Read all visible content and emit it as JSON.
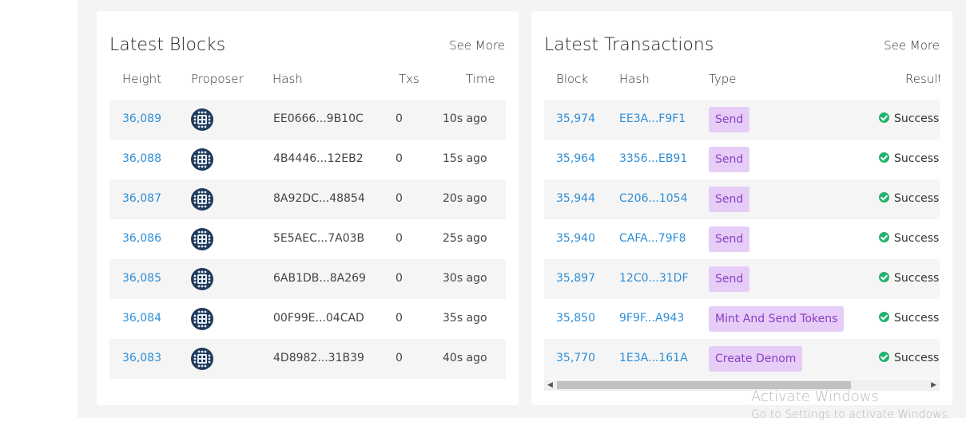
{
  "latest_blocks": {
    "title": "Latest Blocks",
    "see_more": "See More",
    "columns": [
      "Height",
      "Proposer",
      "Hash",
      "Txs",
      "Time"
    ],
    "rows": [
      {
        "height": "36,089",
        "hash": "EE0666...9B10C",
        "txs": "0",
        "time": "10s ago"
      },
      {
        "height": "36,088",
        "hash": "4B4446...12EB2",
        "txs": "0",
        "time": "15s ago"
      },
      {
        "height": "36,087",
        "hash": "8A92DC...48854",
        "txs": "0",
        "time": "20s ago"
      },
      {
        "height": "36,086",
        "hash": "5E5AEC...7A03B",
        "txs": "0",
        "time": "25s ago"
      },
      {
        "height": "36,085",
        "hash": "6AB1DB...8A269",
        "txs": "0",
        "time": "30s ago"
      },
      {
        "height": "36,084",
        "hash": "00F99E...04CAD",
        "txs": "0",
        "time": "35s ago"
      },
      {
        "height": "36,083",
        "hash": "4D8982...31B39",
        "txs": "0",
        "time": "40s ago"
      }
    ]
  },
  "latest_transactions": {
    "title": "Latest Transactions",
    "see_more": "See More",
    "columns": [
      "Block",
      "Hash",
      "Type",
      "Result"
    ],
    "rows": [
      {
        "block": "35,974",
        "hash": "EE3A...F9F1",
        "type": "Send",
        "result": "Success"
      },
      {
        "block": "35,964",
        "hash": "3356...EB91",
        "type": "Send",
        "result": "Success"
      },
      {
        "block": "35,944",
        "hash": "C206...1054",
        "type": "Send",
        "result": "Success"
      },
      {
        "block": "35,940",
        "hash": "CAFA...79F8",
        "type": "Send",
        "result": "Success"
      },
      {
        "block": "35,897",
        "hash": "12C0...31DF",
        "type": "Send",
        "result": "Success"
      },
      {
        "block": "35,850",
        "hash": "9F9F...A943",
        "type": "Mint And Send Tokens",
        "result": "Success"
      },
      {
        "block": "35,770",
        "hash": "1E3A...161A",
        "type": "Create Denom",
        "result": "Success"
      }
    ]
  },
  "watermark": {
    "line1": "Activate Windows",
    "line2": "Go to Settings to activate Windows."
  },
  "colors": {
    "link": "#2e8ed8",
    "badge_bg": "#e6cdf7",
    "badge_text": "#8b3fc4",
    "success": "#23b26d",
    "proposer_icon_bg": "#1f3b5c"
  },
  "icons": {
    "proposer": "validator-avatar-icon",
    "result": "check-circle-icon",
    "scroll_left": "arrow-left-icon",
    "scroll_right": "arrow-right-icon"
  }
}
